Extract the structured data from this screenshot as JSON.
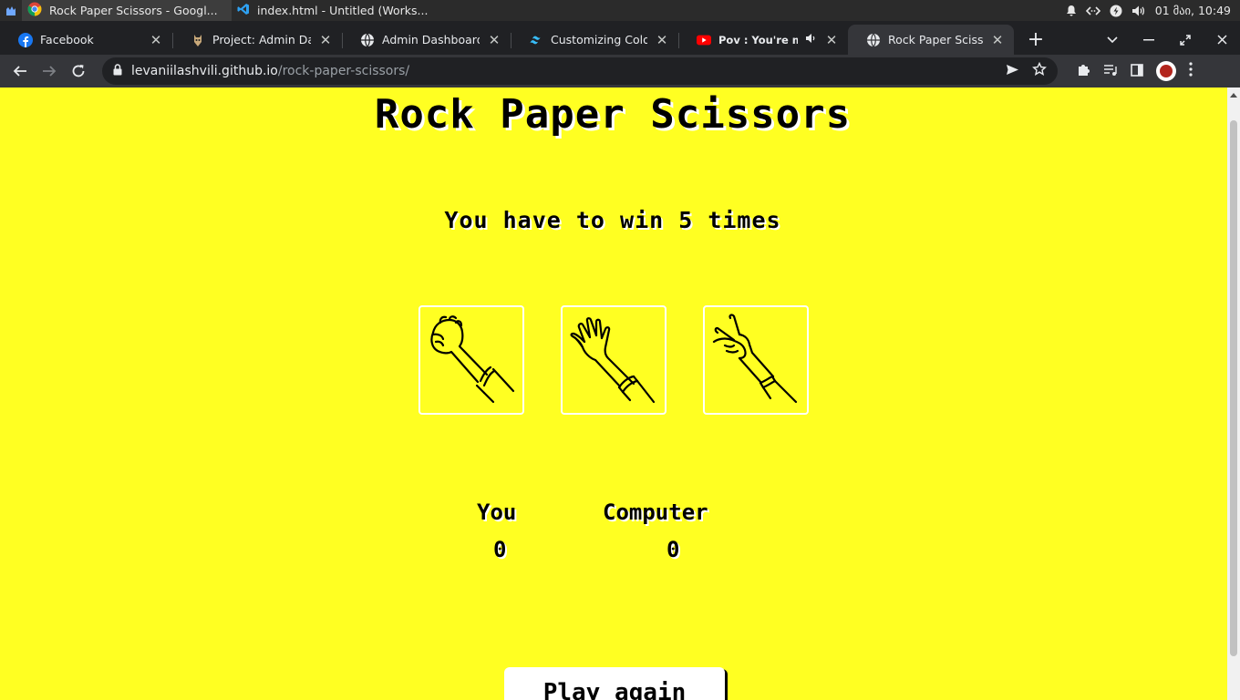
{
  "os_bar": {
    "tasks": [
      {
        "label": "Rock Paper Scissors - Googl...",
        "icon": "chrome-icon",
        "active": true
      },
      {
        "label": "index.html - Untitled (Works...",
        "icon": "vscode-icon",
        "active": false
      }
    ],
    "clock": "01  მაი, 10:49"
  },
  "tabs": [
    {
      "title": "Facebook",
      "icon": "facebook-icon"
    },
    {
      "title": "Project: Admin Dashb",
      "icon": "odin-icon"
    },
    {
      "title": "Admin Dashboard",
      "icon": "globe-icon"
    },
    {
      "title": "Customizing Colors - ",
      "icon": "tailwind-icon"
    },
    {
      "title": "Pov : You're misun",
      "icon": "youtube-icon",
      "audio": true
    },
    {
      "title": "Rock Paper Scissors",
      "icon": "globe-icon",
      "active": true
    }
  ],
  "toolbar": {
    "url_host": "levaniilashvili.github.io",
    "url_path": "/rock-paper-scissors/"
  },
  "game": {
    "title": "Rock Paper Scissors",
    "instruction": "You have to win 5 times",
    "choices": [
      {
        "name": "rock",
        "icon": "rock-hand-icon"
      },
      {
        "name": "paper",
        "icon": "paper-hand-icon"
      },
      {
        "name": "scissors",
        "icon": "scissors-hand-icon"
      }
    ],
    "player_label": "You",
    "player_score": "0",
    "computer_label": "Computer",
    "computer_score": "0",
    "play_again_label": "Play again"
  },
  "colors": {
    "page_background": "#ffff22",
    "chrome_dark": "#202124",
    "chrome_toolbar": "#35363a"
  }
}
